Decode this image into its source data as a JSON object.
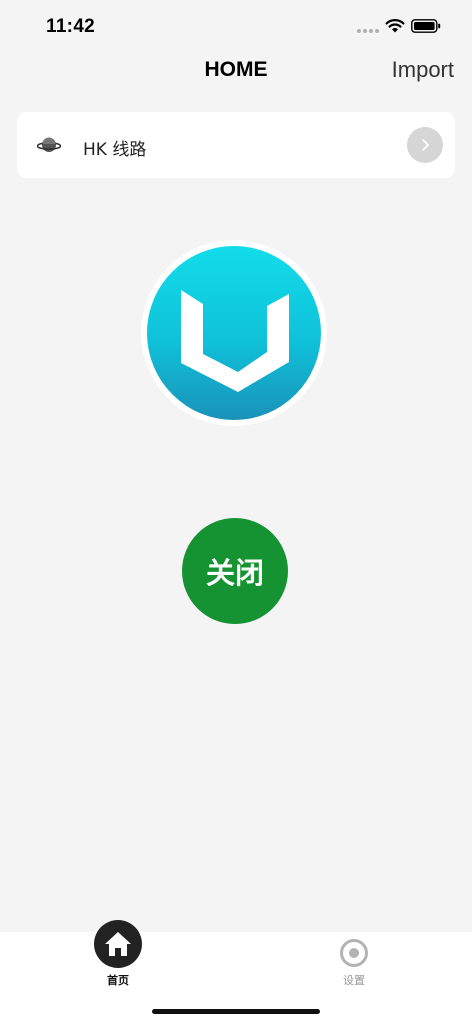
{
  "status_bar": {
    "time": "11:42",
    "icons": [
      "signal-dots-icon",
      "wifi-icon",
      "battery-icon"
    ]
  },
  "nav": {
    "title": "HOME",
    "action_label": "Import"
  },
  "server": {
    "name": "HK 线路",
    "icon": "planet-icon",
    "chevron_icon": "chevron-right-icon"
  },
  "logo": {
    "icon": "app-logo-v",
    "gradient_colors": [
      "#13dcea",
      "#1a92b8"
    ]
  },
  "connection": {
    "button_label": "关闭",
    "button_color": "#159332"
  },
  "tab_bar": {
    "tabs": [
      {
        "label": "首页",
        "icon": "home-icon",
        "active": true
      },
      {
        "label": "设置",
        "icon": "settings-icon",
        "active": false
      }
    ]
  }
}
